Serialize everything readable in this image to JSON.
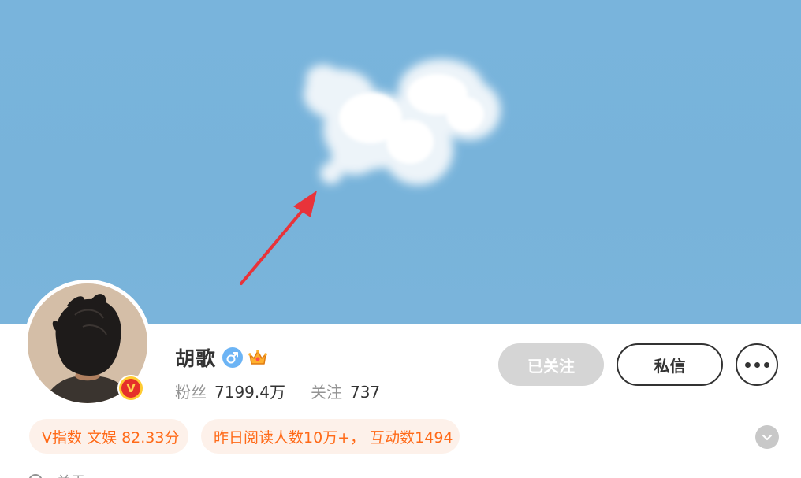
{
  "profile": {
    "name": "胡歌",
    "fans_label": "粉丝",
    "fans_value": "7199.4万",
    "following_label": "关注",
    "following_value": "737",
    "verified_badge": "V"
  },
  "actions": {
    "followed_label": "已关注",
    "message_label": "私信"
  },
  "tags": {
    "vindex": "V指数 文娱 82.33分",
    "read": "昨日阅读人数10万+， 互动数1494"
  },
  "partial_row": {
    "text": "关于"
  },
  "icons": {
    "gender": "male-icon",
    "crown": "crown-icon",
    "more": "more-dots-icon",
    "expand": "chevron-down-icon"
  },
  "colors": {
    "sky": "#79b4dc",
    "accent_orange": "#ff6a18",
    "tag_bg": "#fdf1ea",
    "followed_bg": "#d5d5d5",
    "arrow_red": "#e8333a"
  }
}
